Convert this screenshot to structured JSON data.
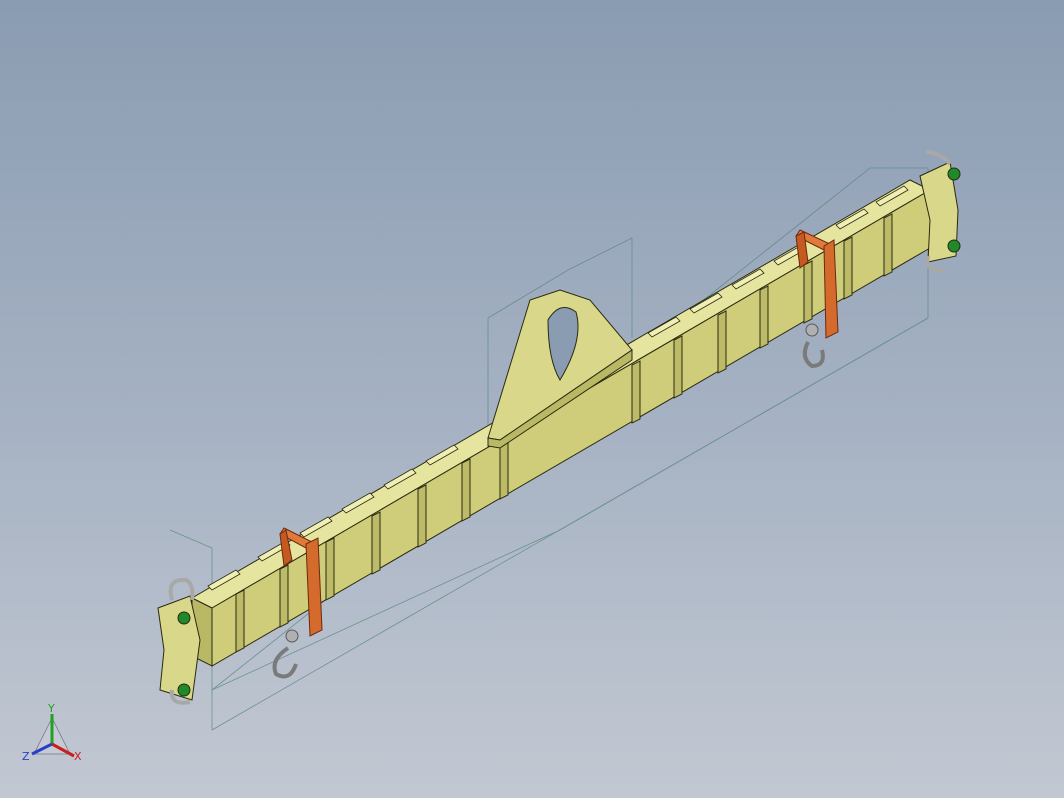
{
  "viewport": {
    "background_top": "#8a9cb2",
    "background_bottom": "#c2c8d2"
  },
  "model": {
    "beam_color": "#d8d78a",
    "beam_edge_color": "#2a2a10",
    "clamp_color": "#d46a2c",
    "hook_color": "#9a9a9a",
    "bolt_color": "#1f8a2a",
    "bounding_box_color": "#5f8a86"
  },
  "triad": {
    "x_label": "X",
    "y_label": "Y",
    "z_label": "Z",
    "x_color": "#c81e1e",
    "y_color": "#22a022",
    "z_color": "#2a3ec8"
  }
}
